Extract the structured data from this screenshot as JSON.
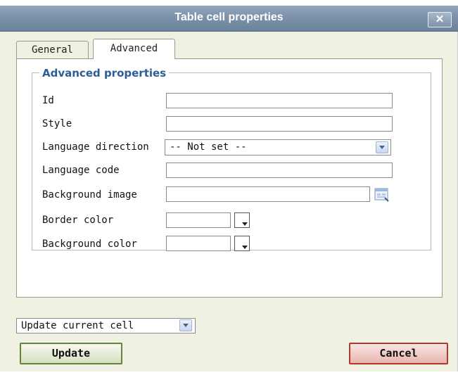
{
  "dialog": {
    "title": "Table cell properties",
    "close_label": "✕"
  },
  "tabs": [
    {
      "label": "General",
      "active": false
    },
    {
      "label": "Advanced",
      "active": true
    }
  ],
  "advanced": {
    "legend": "Advanced properties",
    "fields": {
      "id": {
        "label": "Id",
        "value": ""
      },
      "style": {
        "label": "Style",
        "value": ""
      },
      "language_direction": {
        "label": "Language direction",
        "selected": "-- Not set --"
      },
      "language_code": {
        "label": "Language code",
        "value": ""
      },
      "background_image": {
        "label": "Background image",
        "value": ""
      },
      "border_color": {
        "label": "Border color",
        "value": ""
      },
      "background_color": {
        "label": "Background color",
        "value": ""
      }
    }
  },
  "footer": {
    "scope_selected": "Update current cell",
    "update_label": "Update",
    "cancel_label": "Cancel"
  },
  "colors": {
    "titlebar": "#7b90a9",
    "dialog_bg": "#f1f1e3",
    "legend_text": "#2b5d96",
    "update_border": "#64843c",
    "cancel_border": "#b23a2a"
  }
}
